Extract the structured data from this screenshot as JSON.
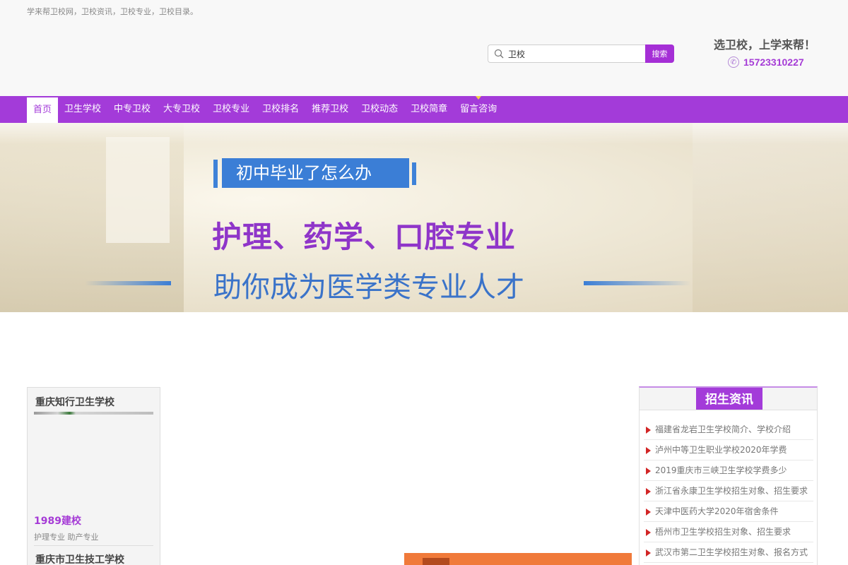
{
  "header": {
    "tagline": "学来帮卫校网，卫校资讯，卫校专业，卫校目录。",
    "search": {
      "value": "卫校",
      "button_label": "搜索",
      "icon": "search-icon"
    },
    "slogan": "选卫校，上学来帮！",
    "phone": "15723310227",
    "phone_icon": "phone-icon"
  },
  "nav": {
    "items": [
      "首页",
      "卫生学校",
      "中专卫校",
      "大专卫校",
      "卫校专业",
      "卫校排名",
      "推荐卫校",
      "卫校动态",
      "卫校简章",
      "留言咨询"
    ],
    "active_index": 0,
    "accent_color": "#a33bd9"
  },
  "banner": {
    "tag": "初中毕业了怎么办",
    "headline": "护理、药学、口腔专业",
    "subline": "助你成为医学类专业人才"
  },
  "school_card": {
    "name": "重庆知行卫生学校",
    "founded": "1989建校",
    "majors": "护理专业   助产专业",
    "next_name": "重庆市卫生技工学校"
  },
  "news": {
    "title": "招生资讯",
    "items": [
      "福建省龙岩卫生学校简介、学校介绍",
      "泸州中等卫生职业学校2020年学费",
      "2019重庆市三峡卫生学校学费多少",
      "浙江省永康卫生学校招生对象、招生要求",
      "天津中医药大学2020年宿舍条件",
      "梧州市卫生学校招生对象、招生要求",
      "武汉市第二卫生学校招生对象、报名方式"
    ]
  }
}
